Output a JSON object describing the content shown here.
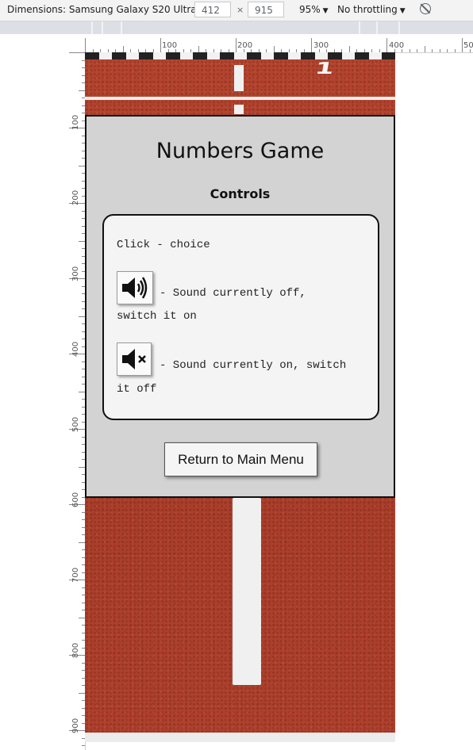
{
  "devtools": {
    "dimensions_label": "Dimensions: Samsung Galaxy S20 Ultra",
    "width": "412",
    "height": "915",
    "zoom": "95%",
    "throttling": "No throttling",
    "times": "×",
    "rotate_icon": "rotate-icon"
  },
  "rulers": {
    "horizontal_ticks": [
      "100",
      "200",
      "300",
      "400",
      "50"
    ],
    "vertical_ticks": [
      "100",
      "200",
      "300",
      "400",
      "500",
      "600",
      "700",
      "800",
      "900"
    ]
  },
  "background": {
    "lane_number": "1"
  },
  "game": {
    "title": "Numbers Game",
    "subtitle": "Controls",
    "controls": {
      "click_text": "Click - choice",
      "sound_on_icon": "speaker-icon",
      "sound_on_line1": "-  Sound  currently  off,",
      "sound_on_line2": "switch it on",
      "sound_off_icon": "speaker-muted-icon",
      "sound_off_line1": "- Sound currently on, switch",
      "sound_off_line2": "it off"
    },
    "main_menu_button": "Return to Main Menu"
  }
}
